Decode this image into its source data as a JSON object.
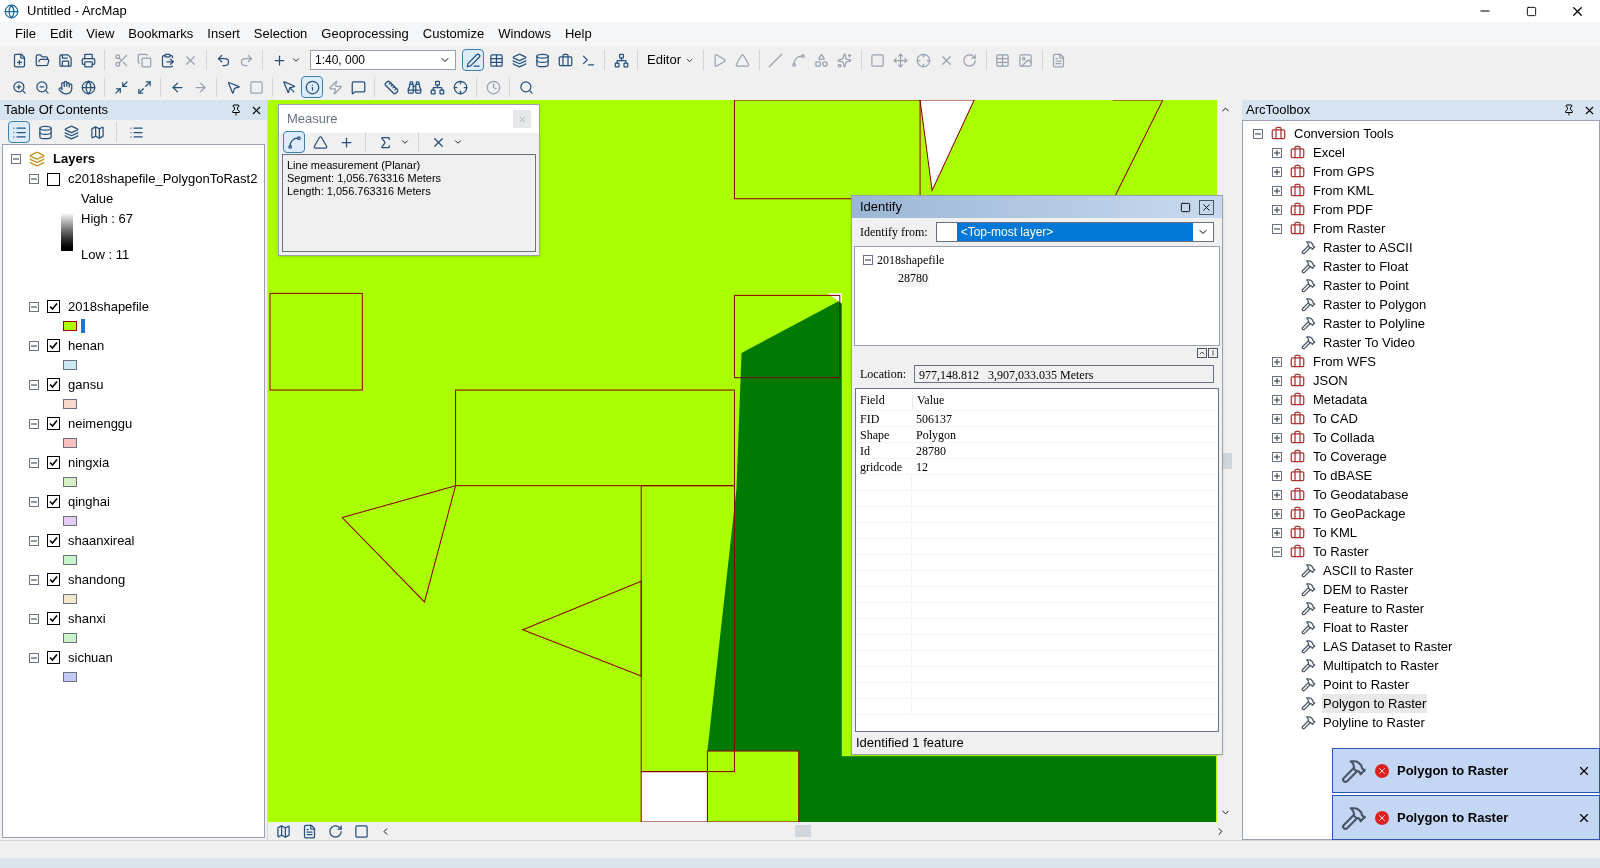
{
  "window": {
    "title": "Untitled - ArcMap"
  },
  "menu": [
    "File",
    "Edit",
    "View",
    "Bookmarks",
    "Insert",
    "Selection",
    "Geoprocessing",
    "Customize",
    "Windows",
    "Help"
  ],
  "toolbar": {
    "scale": "1:40, 000",
    "editor": "Editor"
  },
  "toc": {
    "title": "Table Of Contents",
    "root": "Layers",
    "root_expanded": true,
    "layers": [
      {
        "kind": "raster",
        "name": "c2018shapefile_PolygonToRast2",
        "checked": false,
        "expanded": true,
        "legend_title": "Value",
        "high": "High : 67",
        "low": "Low : 11"
      },
      {
        "kind": "feature",
        "name": "2018shapefile",
        "checked": true,
        "expanded": true,
        "color": "#aaff00"
      },
      {
        "kind": "feature",
        "name": "henan",
        "checked": true,
        "expanded": true,
        "color": "#cce8f4"
      },
      {
        "kind": "feature",
        "name": "gansu",
        "checked": true,
        "expanded": true,
        "color": "#f6d9cc"
      },
      {
        "kind": "feature",
        "name": "neimenggu",
        "checked": true,
        "expanded": true,
        "color": "#f8bfbf"
      },
      {
        "kind": "feature",
        "name": "ningxia",
        "checked": true,
        "expanded": true,
        "color": "#d4f0c4"
      },
      {
        "kind": "feature",
        "name": "qinghai",
        "checked": true,
        "expanded": true,
        "color": "#e6ccf2"
      },
      {
        "kind": "feature",
        "name": "shaanxireal",
        "checked": true,
        "expanded": true,
        "color": "#ccf2cc"
      },
      {
        "kind": "feature",
        "name": "shandong",
        "checked": true,
        "expanded": true,
        "color": "#f2e8cc"
      },
      {
        "kind": "feature",
        "name": "shanxi",
        "checked": true,
        "expanded": true,
        "color": "#ccf2c8"
      },
      {
        "kind": "feature",
        "name": "sichuan",
        "checked": true,
        "expanded": true,
        "color": "#c4c8f2"
      }
    ]
  },
  "measure": {
    "title": "Measure",
    "lines": [
      "Line measurement (Planar)",
      "Segment: 1,056.763316 Meters",
      "Length: 1,056.763316 Meters"
    ]
  },
  "identify": {
    "title": "Identify",
    "from_label": "Identify from:",
    "from_value": "<Top-most layer>",
    "tree": {
      "label": "2018shapefile",
      "expanded": true,
      "children": [
        {
          "label": "28780"
        }
      ]
    },
    "location_label": "Location:",
    "location": "977,148.812   3,907,033.035 Meters",
    "columns": [
      "Field",
      "Value"
    ],
    "rows": [
      [
        "FID",
        "506137"
      ],
      [
        "Shape",
        "Polygon"
      ],
      [
        "Id",
        "28780"
      ],
      [
        "gridcode",
        "12"
      ]
    ],
    "status": "Identified 1 feature"
  },
  "toolbox": {
    "title": "ArcToolbox",
    "root": {
      "label": "Conversion Tools",
      "expanded": true,
      "children": [
        {
          "kind": "toolset",
          "label": "Excel",
          "expanded": false
        },
        {
          "kind": "toolset",
          "label": "From GPS",
          "expanded": false
        },
        {
          "kind": "toolset",
          "label": "From KML",
          "expanded": false
        },
        {
          "kind": "toolset",
          "label": "From PDF",
          "expanded": false
        },
        {
          "kind": "toolset",
          "label": "From Raster",
          "expanded": true,
          "children": [
            {
              "label": "Raster to ASCII",
              "selected": false
            },
            {
              "label": "Raster to Float",
              "selected": false
            },
            {
              "label": "Raster to Point",
              "selected": false
            },
            {
              "label": "Raster to Polygon",
              "selected": false
            },
            {
              "label": "Raster to Polyline",
              "selected": false
            },
            {
              "label": "Raster To Video",
              "selected": false
            }
          ]
        },
        {
          "kind": "toolset",
          "label": "From WFS",
          "expanded": false
        },
        {
          "kind": "toolset",
          "label": "JSON",
          "expanded": false
        },
        {
          "kind": "toolset",
          "label": "Metadata",
          "expanded": false
        },
        {
          "kind": "toolset",
          "label": "To CAD",
          "expanded": false
        },
        {
          "kind": "toolset",
          "label": "To Collada",
          "expanded": false
        },
        {
          "kind": "toolset",
          "label": "To Coverage",
          "expanded": false
        },
        {
          "kind": "toolset",
          "label": "To dBASE",
          "expanded": false
        },
        {
          "kind": "toolset",
          "label": "To Geodatabase",
          "expanded": false
        },
        {
          "kind": "toolset",
          "label": "To GeoPackage",
          "expanded": false
        },
        {
          "kind": "toolset",
          "label": "To KML",
          "expanded": false
        },
        {
          "kind": "toolset",
          "label": "To Raster",
          "expanded": true,
          "children": [
            {
              "label": "ASCII to Raster",
              "selected": false
            },
            {
              "label": "DEM to Raster",
              "selected": false
            },
            {
              "label": "Feature to Raster",
              "selected": false
            },
            {
              "label": "Float to Raster",
              "selected": false
            },
            {
              "label": "LAS Dataset to Raster",
              "selected": false
            },
            {
              "label": "Multipatch to Raster",
              "selected": false
            },
            {
              "label": "Point to Raster",
              "selected": false
            },
            {
              "label": "Polygon to Raster",
              "selected": true
            },
            {
              "label": "Polyline to Raster",
              "selected": false
            }
          ]
        }
      ]
    }
  },
  "notifications": [
    {
      "kind": "error",
      "title": "Polygon to Raster"
    },
    {
      "kind": "error",
      "title": "Polygon to Raster"
    }
  ]
}
